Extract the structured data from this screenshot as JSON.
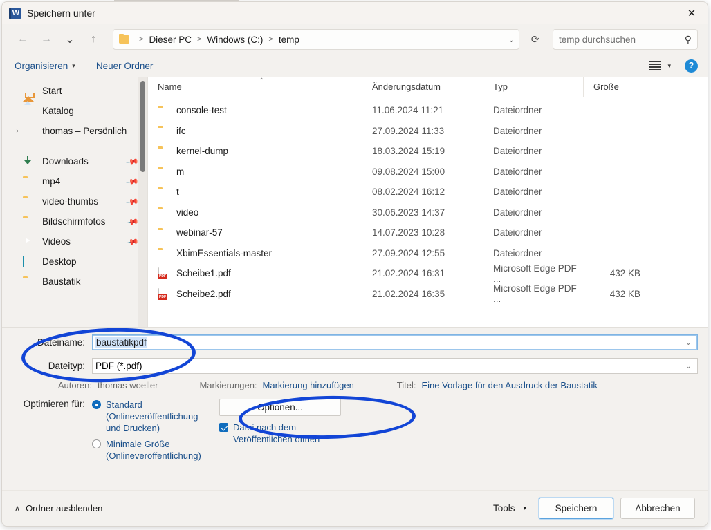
{
  "window": {
    "title": "Speichern unter",
    "app_icon": "word-icon",
    "app_icon_letter": "W",
    "close_label": "✕"
  },
  "nav": {
    "back": "←",
    "forward": "→",
    "recent": "⌄",
    "up": "↑",
    "refresh": "⟳",
    "breadcrumb": [
      "Dieser PC",
      "Windows (C:)",
      "temp"
    ],
    "breadcrumb_caret": "⌄"
  },
  "search": {
    "placeholder": "temp durchsuchen",
    "value": "",
    "icon": "search-icon"
  },
  "toolbar": {
    "organize": "Organisieren",
    "organize_caret": "▾",
    "new_folder": "Neuer Ordner",
    "view_caret": "▾",
    "help": "?"
  },
  "sidebar": {
    "items": [
      {
        "label": "Start",
        "icon": "home-icon",
        "pin": false,
        "chevron": false
      },
      {
        "label": "Katalog",
        "icon": "picture-icon",
        "pin": false,
        "chevron": false
      },
      {
        "label": "thomas – Persönlich",
        "icon": "cloud-icon",
        "pin": false,
        "chevron": true
      },
      {
        "label": "Downloads",
        "icon": "download-icon",
        "pin": true,
        "chevron": false
      },
      {
        "label": "mp4",
        "icon": "folder-icon",
        "pin": true,
        "chevron": false
      },
      {
        "label": "video-thumbs",
        "icon": "folder-icon",
        "pin": true,
        "chevron": false
      },
      {
        "label": "Bildschirmfotos",
        "icon": "folder-icon",
        "pin": true,
        "chevron": false
      },
      {
        "label": "Videos",
        "icon": "video-icon",
        "pin": true,
        "chevron": false
      },
      {
        "label": "Desktop",
        "icon": "desktop-icon",
        "pin": false,
        "chevron": false
      },
      {
        "label": "Baustatik",
        "icon": "folder-icon",
        "pin": false,
        "chevron": false
      }
    ],
    "pin_glyph": "📌"
  },
  "filelist": {
    "columns": [
      "Name",
      "Änderungsdatum",
      "Typ",
      "Größe"
    ],
    "sort_caret": "⌃",
    "rows": [
      {
        "name": "console-test",
        "date": "11.06.2024 11:21",
        "type": "Dateiordner",
        "size": "",
        "icon": "folder-icon"
      },
      {
        "name": "ifc",
        "date": "27.09.2024 11:33",
        "type": "Dateiordner",
        "size": "",
        "icon": "folder-icon"
      },
      {
        "name": "kernel-dump",
        "date": "18.03.2024 15:19",
        "type": "Dateiordner",
        "size": "",
        "icon": "folder-icon"
      },
      {
        "name": "m",
        "date": "09.08.2024 15:00",
        "type": "Dateiordner",
        "size": "",
        "icon": "folder-icon"
      },
      {
        "name": "t",
        "date": "08.02.2024 16:12",
        "type": "Dateiordner",
        "size": "",
        "icon": "folder-icon"
      },
      {
        "name": "video",
        "date": "30.06.2023 14:37",
        "type": "Dateiordner",
        "size": "",
        "icon": "folder-icon"
      },
      {
        "name": "webinar-57",
        "date": "14.07.2023 10:28",
        "type": "Dateiordner",
        "size": "",
        "icon": "folder-icon"
      },
      {
        "name": "XbimEssentials-master",
        "date": "27.09.2024 12:55",
        "type": "Dateiordner",
        "size": "",
        "icon": "folder-icon"
      },
      {
        "name": "Scheibe1.pdf",
        "date": "21.02.2024 16:31",
        "type": "Microsoft Edge PDF ...",
        "size": "432 KB",
        "icon": "pdf-icon"
      },
      {
        "name": "Scheibe2.pdf",
        "date": "21.02.2024 16:35",
        "type": "Microsoft Edge PDF ...",
        "size": "432 KB",
        "icon": "pdf-icon"
      }
    ]
  },
  "form": {
    "filename_label": "Dateiname:",
    "filename_value": "baustatikpdf",
    "filetype_label": "Dateityp:",
    "filetype_value": "PDF (*.pdf)",
    "combo_caret": "⌄",
    "authors_label": "Autoren:",
    "authors_value": "thomas woeller",
    "tags_label": "Markierungen:",
    "tags_value": "Markierung hinzufügen",
    "title_label": "Titel:",
    "title_value": "Eine Vorlage für den Ausdruck der Baustatik",
    "optimize_label": "Optimieren für:",
    "radio_standard": "Standard (Onlineveröffentlichung und Drucken)",
    "radio_standard_line1": "Standard",
    "radio_standard_line2": "(Onlineveröffentlichung und Drucken)",
    "radio_minimal_line1": "Minimale Größe",
    "radio_minimal_line2": "(Onlineveröffentlichung)",
    "options_button": "Optionen...",
    "open_after_publish": "Datei nach dem Veröffentlichen öffnen"
  },
  "footer": {
    "hide_folders": "Ordner ausblenden",
    "hide_caret": "∧",
    "tools": "Tools",
    "tools_caret": "▾",
    "save": "Speichern",
    "cancel": "Abbrechen"
  },
  "annotations": {
    "ellipse_1_target": "filename-and-filetype-fields",
    "ellipse_2_target": "options-button",
    "color": "#1245d6"
  }
}
